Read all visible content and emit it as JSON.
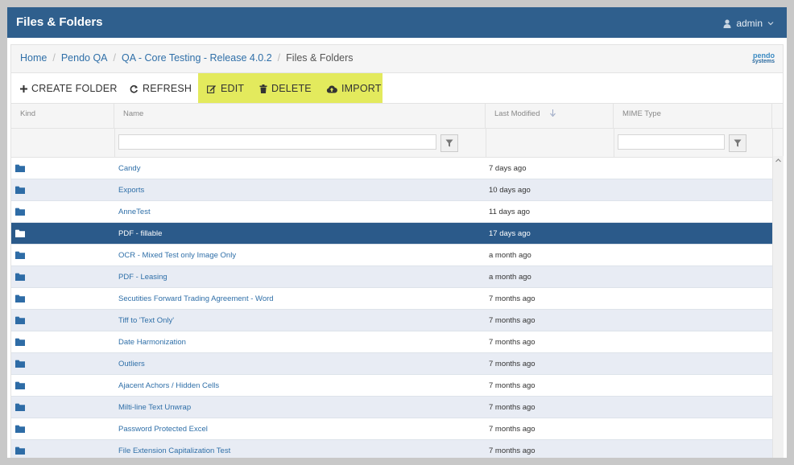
{
  "header": {
    "title": "Files & Folders",
    "user": "admin"
  },
  "breadcrumb": [
    {
      "label": "Home",
      "link": true
    },
    {
      "label": "Pendo QA",
      "link": true
    },
    {
      "label": "QA - Core Testing - Release 4.0.2",
      "link": true
    },
    {
      "label": "Files & Folders",
      "link": false
    }
  ],
  "logo": {
    "line1": "pendo",
    "line2": "systems"
  },
  "toolbar": {
    "create_folder": "CREATE FOLDER",
    "refresh": "REFRESH",
    "edit": "EDIT",
    "delete": "DELETE",
    "import": "IMPORT"
  },
  "columns": {
    "kind": "Kind",
    "name": "Name",
    "modified": "Last Modified",
    "mime": "MIME Type"
  },
  "colors": {
    "header": "#2f5f8d",
    "selected": "#2b5a8a",
    "link": "#2f6fa8",
    "highlight": "#e3ea5d"
  },
  "rows": [
    {
      "name": "Candy",
      "modified": "7 days ago"
    },
    {
      "name": "Exports",
      "modified": "10 days ago"
    },
    {
      "name": "AnneTest",
      "modified": "11 days ago"
    },
    {
      "name": "PDF - fillable",
      "modified": "17 days ago",
      "selected": true
    },
    {
      "name": "OCR - Mixed Test only Image Only",
      "modified": "a month ago"
    },
    {
      "name": "PDF - Leasing",
      "modified": "a month ago"
    },
    {
      "name": "Secutities Forward Trading Agreement - Word",
      "modified": "7 months ago"
    },
    {
      "name": "Tiff to 'Text Only'",
      "modified": "7 months ago"
    },
    {
      "name": "Date Harmonization",
      "modified": "7 months ago"
    },
    {
      "name": "Outliers",
      "modified": "7 months ago"
    },
    {
      "name": "Ajacent Achors / Hidden Cells",
      "modified": "7 months ago"
    },
    {
      "name": "Milti-line Text Unwrap",
      "modified": "7 months ago"
    },
    {
      "name": "Password Protected Excel",
      "modified": "7 months ago"
    },
    {
      "name": "File Extension Capitalization Test",
      "modified": "7 months ago"
    }
  ]
}
